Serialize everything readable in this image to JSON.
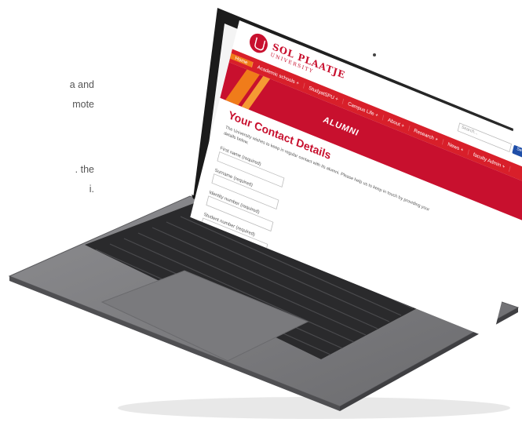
{
  "left_text": {
    "lines": [
      "a and",
      "mote",
      ".  the",
      "i."
    ]
  },
  "website": {
    "logo": {
      "name": "SOL PLAATJE",
      "subtitle": "UNIVERSITY"
    },
    "nav": {
      "items": [
        "Home",
        "Academic schools +",
        "StudyatSPU +",
        "Campus Life +",
        "About +",
        "Research +",
        "News +",
        "faculty Admin +"
      ]
    },
    "search": {
      "placeholder": "Search...",
      "button": "Search"
    },
    "banner": {
      "title": "ALUMNI"
    },
    "form": {
      "heading": "Your Contact Details",
      "intro": "The University wishes to keep in regular contact with its alumni.  Please help us to keep in touch by providing your details below.",
      "fields": [
        "First name (required)",
        "Surname (required)",
        "Identity number (required)",
        "Student number (required)"
      ]
    }
  },
  "colors": {
    "brand_red": "#c8102e",
    "nav_red": "#d81f2a",
    "accent_orange": "#f07c1a",
    "search_blue": "#1f4ea8"
  }
}
